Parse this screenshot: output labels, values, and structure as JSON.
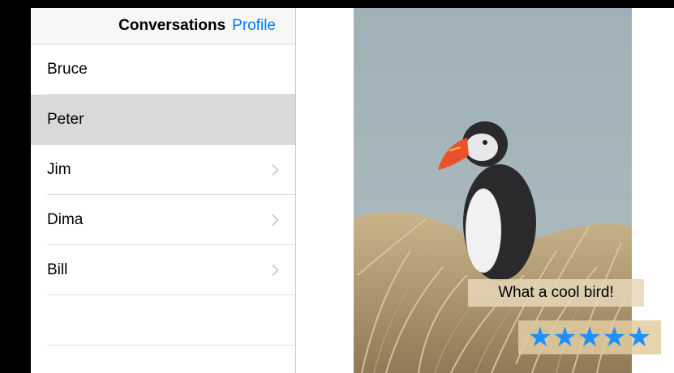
{
  "nav": {
    "title": "Conversations",
    "profile_label": "Profile"
  },
  "conversations": [
    {
      "name": "Bruce",
      "selected": false,
      "chevron": false
    },
    {
      "name": "Peter",
      "selected": true,
      "chevron": false
    },
    {
      "name": "Jim",
      "selected": false,
      "chevron": true
    },
    {
      "name": "Dima",
      "selected": false,
      "chevron": true
    },
    {
      "name": "Bill",
      "selected": false,
      "chevron": true
    }
  ],
  "detail": {
    "caption": "What a cool bird!",
    "rating": {
      "value": 5,
      "max": 5,
      "star_glyph": "★"
    },
    "photo_icon": "puffin-photo"
  },
  "colors": {
    "accent": "#007aff",
    "selected_row": "#d9d9d9",
    "star": "#1e90ff"
  }
}
